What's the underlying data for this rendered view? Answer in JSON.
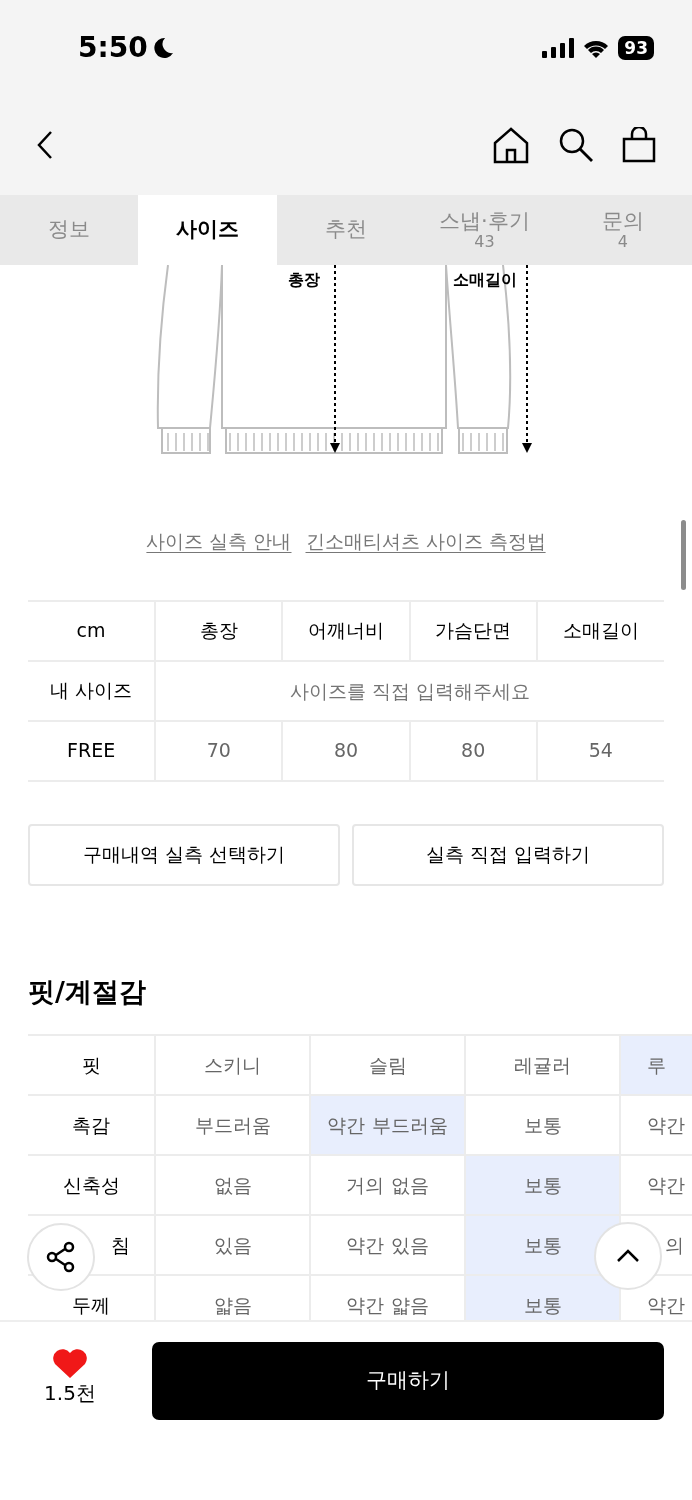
{
  "status_bar": {
    "time": "5:50",
    "battery": "93"
  },
  "tabs": [
    {
      "label": "정보",
      "selected": false
    },
    {
      "label": "사이즈",
      "selected": true
    },
    {
      "label": "추천",
      "selected": false
    },
    {
      "label": "스냅·후기",
      "count": "43",
      "selected": false
    },
    {
      "label": "문의",
      "count": "4",
      "selected": false
    }
  ],
  "diagram": {
    "labels": [
      "총장",
      "소매길이"
    ]
  },
  "guide_links": [
    "사이즈 실측 안내",
    "긴소매티셔츠 사이즈 측정법"
  ],
  "size_table": {
    "columns": [
      "cm",
      "총장",
      "어깨너비",
      "가슴단면",
      "소매길이"
    ],
    "rows": [
      {
        "kind": "input",
        "label": "내 사이즈",
        "placeholder": "사이즈를 직접 입력해주세요"
      },
      {
        "kind": "values",
        "label": "FREE",
        "values": [
          "70",
          "80",
          "80",
          "54"
        ]
      }
    ]
  },
  "size_buttons": [
    "구매내역 실측 선택하기",
    "실측 직접 입력하기"
  ],
  "fit": {
    "title": "핏/계절감",
    "rows": [
      {
        "label": "핏",
        "cells": [
          {
            "text": "스키니",
            "selected": false
          },
          {
            "text": "슬림",
            "selected": false
          },
          {
            "text": "레귤러",
            "selected": false
          },
          {
            "text": "루",
            "selected": true
          }
        ]
      },
      {
        "label": "촉감",
        "cells": [
          {
            "text": "부드러움",
            "selected": false
          },
          {
            "text": "약간 부드러움",
            "selected": true
          },
          {
            "text": "보통",
            "selected": false
          },
          {
            "text": "약간",
            "selected": false
          }
        ]
      },
      {
        "label": "신축성",
        "cells": [
          {
            "text": "없음",
            "selected": false
          },
          {
            "text": "거의 없음",
            "selected": false
          },
          {
            "text": "보통",
            "selected": true
          },
          {
            "text": "약간",
            "selected": false
          }
        ]
      },
      {
        "label": "침",
        "cells": [
          {
            "text": "있음",
            "selected": false
          },
          {
            "text": "약간 있음",
            "selected": false
          },
          {
            "text": "보통",
            "selected": true
          },
          {
            "text": "의",
            "selected": false
          }
        ]
      },
      {
        "label": "두께",
        "cells": [
          {
            "text": "얇음",
            "selected": false
          },
          {
            "text": "약간 얇음",
            "selected": false
          },
          {
            "text": "보통",
            "selected": true
          },
          {
            "text": "약간",
            "selected": false
          }
        ]
      }
    ]
  },
  "bottom_bar": {
    "likes": "1.5천",
    "buy_button": "구매하기"
  }
}
